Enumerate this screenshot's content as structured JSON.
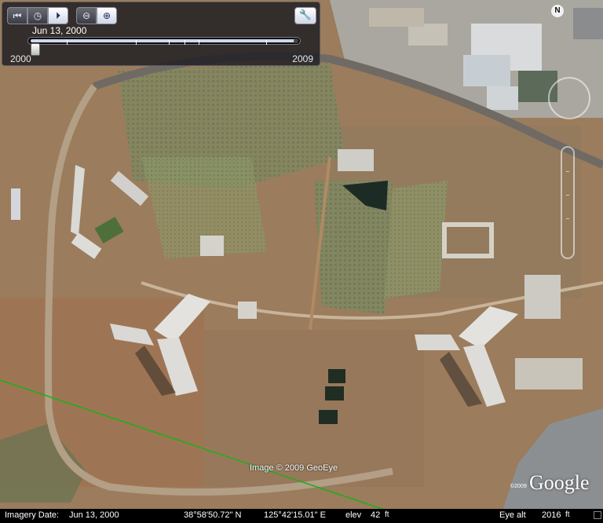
{
  "time_slider": {
    "current_date": "Jun 13, 2000",
    "start_year": "2000",
    "end_year": "2009",
    "buttons": {
      "first_icon": "skip-to-start-icon",
      "clock_icon": "clock-icon",
      "play_icon": "play-icon",
      "zoom_out_icon": "zoom-out-icon",
      "zoom_in_icon": "zoom-in-icon",
      "settings_icon": "wrench-icon"
    },
    "position_fraction": 0.0
  },
  "compass": {
    "label": "N"
  },
  "attribution": {
    "image_credit": "Image © 2009 GeoEye"
  },
  "brand": {
    "logo": "Google",
    "copyright": "©2009"
  },
  "status_bar": {
    "imagery_date_label": "Imagery Date:",
    "imagery_date": "Jun 13, 2000",
    "latitude": "38°58'50.72\" N",
    "longitude": "125°42'15.01\" E",
    "elev_label": "elev",
    "elevation_value": "42",
    "elevation_unit": "ft",
    "eye_alt_label": "Eye alt",
    "eye_alt_value": "2016",
    "eye_alt_unit": "ft"
  },
  "colors": {
    "terrain": "#9a7a58",
    "overlay_line": "#19b01c",
    "panel_bg": "#1c1c22"
  }
}
